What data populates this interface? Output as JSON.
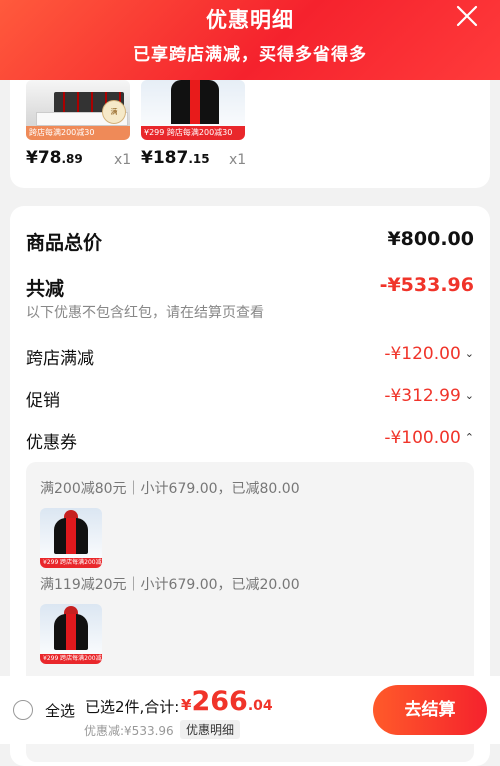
{
  "header": {
    "title": "优惠明细",
    "subtitle": "已享跨店满减，买得多省得多"
  },
  "products": [
    {
      "price_int": "¥78",
      "price_dec": ".89",
      "qty": "x1",
      "promo": "跨店每满200减30",
      "promo_tag": "满"
    },
    {
      "price_int": "¥187",
      "price_dec": ".15",
      "qty": "x1",
      "promo": "跨店每满200减30",
      "promo_tag": "¥299"
    }
  ],
  "summary": {
    "total_label": "商品总价",
    "total_value": "¥800.00",
    "reduce_label": "共减",
    "reduce_value": "-¥533.96",
    "note": "以下优惠不包含红包，请在结算页查看",
    "items": [
      {
        "label": "跨店满减",
        "value": "-¥120.00",
        "chevron": "chevron-down-icon"
      },
      {
        "label": "促销",
        "value": "-¥312.99",
        "chevron": "chevron-down-icon"
      },
      {
        "label": "优惠券",
        "value": "-¥100.00",
        "chevron": "chevron-up-icon"
      }
    ]
  },
  "coupons": [
    {
      "text": "满200减80元｜小计679.00，已减80.00",
      "promo": "¥299 跨店每满200减30"
    },
    {
      "text": "满119减20元｜小计679.00，已减20.00",
      "promo": "¥299 跨店每满200减30"
    }
  ],
  "bottom": {
    "select_all": "全选",
    "selected_info": "已选2件,合计:",
    "total_currency": "¥",
    "total_int": "266",
    "total_dec": ".04",
    "saved": "优惠减:¥533.96",
    "detail_button": "优惠明细",
    "checkout": "去结算"
  },
  "colors": {
    "accent": "#f0342a",
    "header_start": "#ff5a3c",
    "header_end": "#f5222d"
  }
}
